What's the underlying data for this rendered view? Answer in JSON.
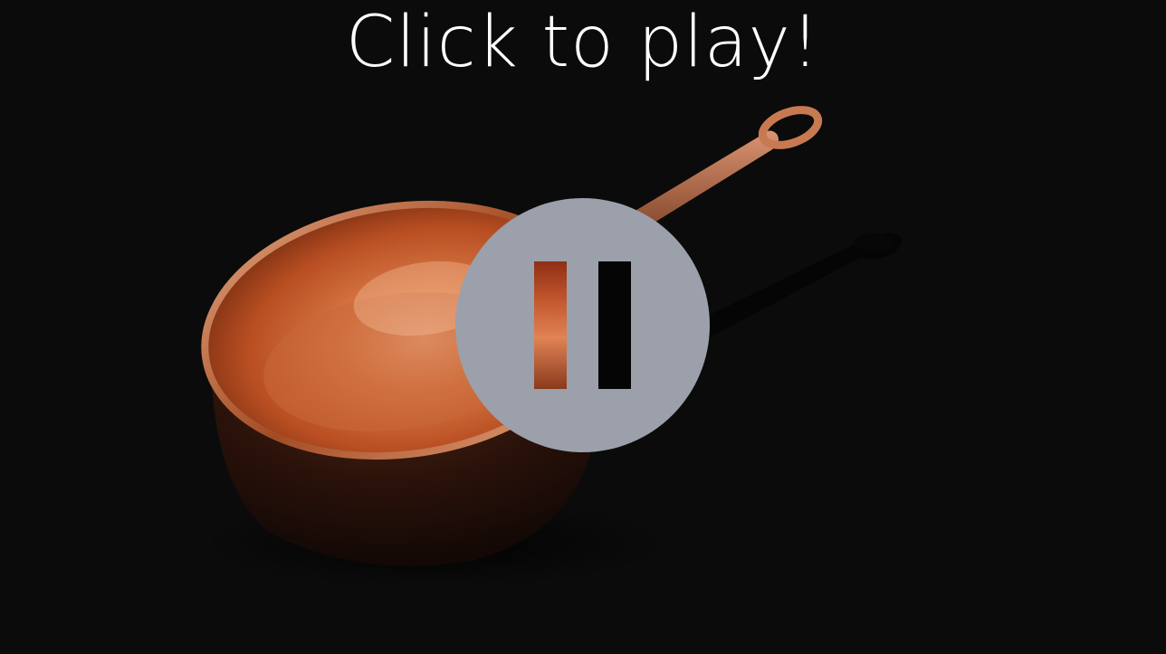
{
  "overlay": {
    "title": "Click to play!"
  },
  "player": {
    "state_icon": "pause-icon",
    "toggle_color": "#9ba0ab"
  },
  "scene": {
    "subject": "copper-saucepan",
    "background_color": "#0b0b0b",
    "copper_color": "#c8683a"
  }
}
